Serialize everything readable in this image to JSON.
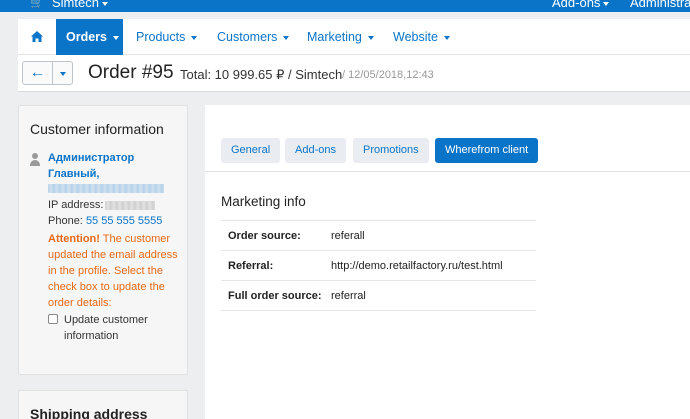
{
  "topbar": {
    "store": "Simtech",
    "addons": "Add-ons",
    "admin": "Administration"
  },
  "nav": {
    "items": [
      {
        "label": "Orders"
      },
      {
        "label": "Products"
      },
      {
        "label": "Customers"
      },
      {
        "label": "Marketing"
      },
      {
        "label": "Website"
      }
    ]
  },
  "header": {
    "title": "Order #95",
    "total": "Total: 10 999.65 ₽ / Simtech",
    "date": "/ 12/05/2018,12:43"
  },
  "customer": {
    "heading": "Customer information",
    "name": "Администратор Главный,",
    "ip_label": "IP address:",
    "phone_label": "Phone:",
    "phone": "55 55 555 5555",
    "attention_label": "Attention!",
    "attention_text": "The customer updated the email address in the profile. Select the check box to update the order details:",
    "checkbox_label": "Update customer information"
  },
  "shipping": {
    "heading": "Shipping address"
  },
  "tabs": [
    {
      "label": "General"
    },
    {
      "label": "Add-ons"
    },
    {
      "label": "Promotions"
    },
    {
      "label": "Wherefrom client"
    }
  ],
  "marketing": {
    "title": "Marketing info",
    "rows": [
      {
        "key": "Order source:",
        "value": "referall"
      },
      {
        "key": "Referral:",
        "value": "http://demo.retailfactory.ru/test.html"
      },
      {
        "key": "Full order source:",
        "value": "referral"
      }
    ]
  },
  "colors": {
    "accent": "#0a74c8",
    "warning": "#e56a17"
  }
}
